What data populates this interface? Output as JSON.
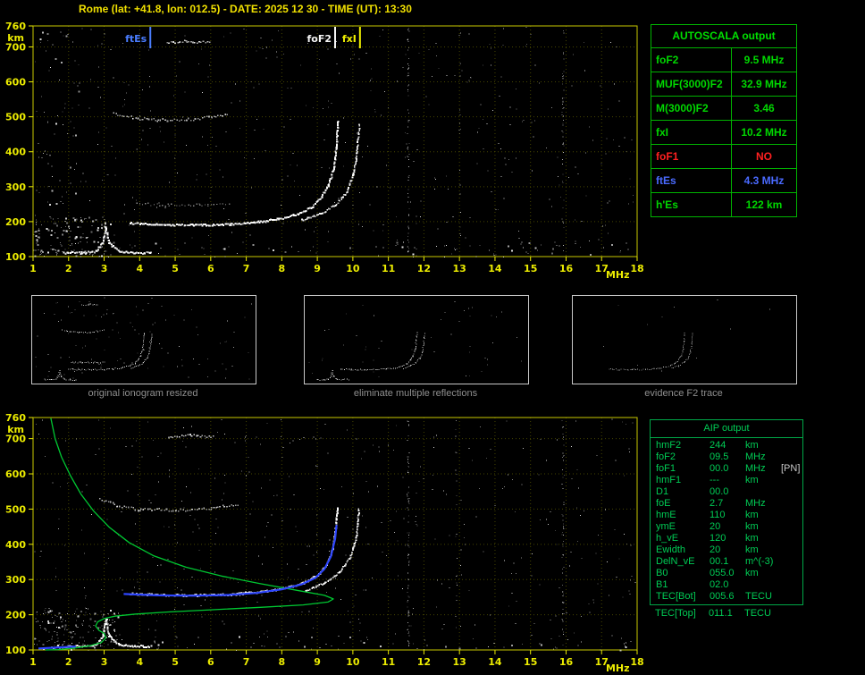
{
  "title": "Rome (lat: +41.8, lon: 012.5) - DATE: 2025 12 30 - TIME (UT): 13:30",
  "colors": {
    "green": "#00d800",
    "red": "#ff2020",
    "blue": "#4a6aff",
    "yellow": "#f0f000",
    "white": "#f5f5f5",
    "axis": "#ecec00"
  },
  "autoscala_table": {
    "header": "AUTOSCALA output",
    "rows": [
      {
        "label": "foF2",
        "value": "9.5 MHz",
        "color": "green"
      },
      {
        "label": "MUF(3000)F2",
        "value": "32.9 MHz",
        "color": "green"
      },
      {
        "label": "M(3000)F2",
        "value": "3.46",
        "color": "green"
      },
      {
        "label": "fxI",
        "value": "10.2 MHz",
        "color": "green"
      },
      {
        "label": "foF1",
        "value": "NO",
        "color": "red"
      },
      {
        "label": "ftEs",
        "value": "4.3 MHz",
        "color": "blue"
      },
      {
        "label": "h'Es",
        "value": "122  km",
        "color": "green"
      }
    ]
  },
  "aip_table": {
    "header": "AIP output",
    "rows": [
      {
        "label": "hmF2",
        "value": "244",
        "unit": "km",
        "extra": ""
      },
      {
        "label": "foF2",
        "value": "09.5",
        "unit": "MHz",
        "extra": ""
      },
      {
        "label": "foF1",
        "value": "00.0",
        "unit": "MHz",
        "extra": "[PN]"
      },
      {
        "label": "hmF1",
        "value": "---",
        "unit": "km",
        "extra": ""
      },
      {
        "label": "D1",
        "value": "00.0",
        "unit": "",
        "extra": ""
      },
      {
        "label": "foE",
        "value": "2.7",
        "unit": "MHz",
        "extra": ""
      },
      {
        "label": "hmE",
        "value": "110",
        "unit": "km",
        "extra": ""
      },
      {
        "label": "ymE",
        "value": "20",
        "unit": "km",
        "extra": ""
      },
      {
        "label": "h_vE",
        "value": "120",
        "unit": "km",
        "extra": ""
      },
      {
        "label": "Ewidth",
        "value": "20",
        "unit": "km",
        "extra": ""
      },
      {
        "label": "DelN_vE",
        "value": "00.1",
        "unit": "m^(-3)",
        "extra": ""
      },
      {
        "label": "B0",
        "value": "055.0",
        "unit": "km",
        "extra": ""
      },
      {
        "label": "B1",
        "value": "02.0",
        "unit": "",
        "extra": ""
      },
      {
        "label": "TEC[Bot]",
        "value": "005.6",
        "unit": "TECU",
        "extra": ""
      }
    ],
    "outside_row": {
      "label": "TEC[Top]",
      "value": "011.1",
      "unit": "TECU",
      "extra": ""
    }
  },
  "thumbnails": [
    {
      "caption": "original ionogram resized",
      "traces": [
        "Es-layer",
        "F-trace-ordinary",
        "F-trace-extraordinary",
        "F-mid-faint",
        "F2-second-order",
        "multiple-700km"
      ],
      "noise": 110,
      "opacity": 0.95,
      "seed": 3
    },
    {
      "caption": "eliminate multiple reflections",
      "traces": [
        "Es-layer",
        "F-trace-ordinary",
        "F-trace-extraordinary"
      ],
      "noise": 45,
      "opacity": 0.95,
      "seed": 4
    },
    {
      "caption": "evidence F2 trace",
      "traces": [
        "F-trace-ordinary",
        "F-trace-extraordinary"
      ],
      "noise": 12,
      "opacity": 0.7,
      "seed": 5
    }
  ],
  "chart_data": [
    {
      "id": "top-ionogram",
      "type": "scatter",
      "title": "autoscaled ionogram",
      "xlabel": "MHz",
      "ylabel": "km",
      "xlim": [
        1,
        18
      ],
      "ylim": [
        100,
        760
      ],
      "xticks": [
        1,
        2,
        3,
        4,
        5,
        6,
        7,
        8,
        9,
        10,
        11,
        12,
        13,
        14,
        15,
        16,
        17,
        18
      ],
      "yticks": [
        100,
        200,
        300,
        400,
        500,
        600,
        700,
        760
      ],
      "markers": [
        {
          "label": "ftEs",
          "x": 4.3,
          "color": "#4a7dff"
        },
        {
          "label": "foF2",
          "x": 9.5,
          "color": "#f5f5f5"
        },
        {
          "label": "fxI",
          "x": 10.2,
          "color": "#f0f000"
        }
      ],
      "traces": [
        {
          "name": "Es-layer",
          "color": "#ffffff",
          "size": 2,
          "step": 1.7,
          "jitter": 1.0,
          "points": [
            [
              1.85,
              112
            ],
            [
              2.35,
              113
            ],
            [
              2.75,
              117
            ],
            [
              2.95,
              142
            ],
            [
              3.03,
              186
            ],
            [
              3.12,
              142
            ],
            [
              3.4,
              117
            ],
            [
              3.85,
              113
            ],
            [
              4.3,
              112
            ]
          ]
        },
        {
          "name": "F-trace-ordinary",
          "color": "#ffffff",
          "size": 2,
          "step": 1.6,
          "jitter": 1.0,
          "points": [
            [
              3.7,
              198
            ],
            [
              4.5,
              193
            ],
            [
              5.5,
              192
            ],
            [
              6.5,
              194
            ],
            [
              7.2,
              199
            ],
            [
              7.9,
              210
            ],
            [
              8.45,
              224
            ],
            [
              8.85,
              245
            ],
            [
              9.1,
              272
            ],
            [
              9.3,
              308
            ],
            [
              9.45,
              358
            ],
            [
              9.52,
              425
            ],
            [
              9.56,
              490
            ]
          ]
        },
        {
          "name": "F-trace-extraordinary",
          "color": "#ffffff",
          "size": 1.8,
          "step": 1.8,
          "jitter": 1.0,
          "points": [
            [
              8.55,
              206
            ],
            [
              9.1,
              224
            ],
            [
              9.5,
              250
            ],
            [
              9.82,
              288
            ],
            [
              10.0,
              338
            ],
            [
              10.1,
              400
            ],
            [
              10.16,
              480
            ]
          ]
        },
        {
          "name": "F-mid-faint",
          "color": "#ffffff",
          "size": 1.4,
          "step": 3.2,
          "jitter": 1.4,
          "op": 0.5,
          "points": [
            [
              3.9,
              253
            ],
            [
              4.8,
              249
            ],
            [
              5.9,
              250
            ],
            [
              6.5,
              254
            ]
          ]
        },
        {
          "name": "F2-second-order",
          "color": "#ffffff",
          "size": 1.6,
          "step": 2.6,
          "jitter": 1.6,
          "op": 0.7,
          "points": [
            [
              3.25,
              512
            ],
            [
              3.8,
              499
            ],
            [
              4.5,
              492
            ],
            [
              5.3,
              493
            ],
            [
              6.0,
              500
            ],
            [
              6.45,
              509
            ]
          ]
        },
        {
          "name": "multiple-700km",
          "color": "#ffffff",
          "size": 1.6,
          "step": 2.4,
          "jitter": 1.2,
          "op": 0.8,
          "points": [
            [
              4.75,
              713
            ],
            [
              5.3,
              718
            ],
            [
              5.95,
              714
            ]
          ]
        }
      ],
      "noise": {
        "seed": 13,
        "count": 380,
        "regions": [
          {
            "x": [
              1,
              3.2
            ],
            "y": [
              100,
              215
            ],
            "count": 140
          },
          {
            "x": [
              1,
              17.8
            ],
            "y": [
              100,
              145
            ],
            "count": 80
          },
          {
            "x": [
              1.05,
              2.3
            ],
            "y": [
              215,
              755
            ],
            "count": 50
          }
        ]
      },
      "streaks": [
        {
          "x": 11.55,
          "count": 70
        },
        {
          "x": 15.9,
          "count": 45
        },
        {
          "x": 13.0,
          "count": 18
        }
      ]
    },
    {
      "id": "bottom-ionogram",
      "type": "scatter",
      "title": "ionogram with restored trace and electron density profile",
      "xlabel": "MHz",
      "ylabel": "km",
      "xlim": [
        1,
        18
      ],
      "ylim": [
        100,
        760
      ],
      "xticks": [
        1,
        2,
        3,
        4,
        5,
        6,
        7,
        8,
        9,
        10,
        11,
        12,
        13,
        14,
        15,
        16,
        17,
        18
      ],
      "yticks": [
        100,
        200,
        300,
        400,
        500,
        600,
        700,
        760
      ],
      "markers": [],
      "traces": [
        {
          "name": "Es-layer",
          "color": "#ffffff",
          "size": 2,
          "step": 1.7,
          "jitter": 1.0,
          "points": [
            [
              1.85,
              112
            ],
            [
              2.35,
              113
            ],
            [
              2.75,
              117
            ],
            [
              2.95,
              142
            ],
            [
              3.03,
              186
            ],
            [
              3.12,
              142
            ],
            [
              3.4,
              117
            ],
            [
              3.85,
              113
            ],
            [
              4.3,
              112
            ]
          ]
        },
        {
          "name": "F-trace-ordinary",
          "color": "#ffffff",
          "size": 2,
          "step": 1.6,
          "jitter": 1.0,
          "points": [
            [
              3.7,
              262
            ],
            [
              4.6,
              258
            ],
            [
              5.6,
              257
            ],
            [
              6.6,
              260
            ],
            [
              7.4,
              267
            ],
            [
              8.1,
              278
            ],
            [
              8.6,
              293
            ],
            [
              9.0,
              315
            ],
            [
              9.25,
              345
            ],
            [
              9.42,
              390
            ],
            [
              9.5,
              450
            ],
            [
              9.54,
              505
            ]
          ]
        },
        {
          "name": "F-trace-extraordinary",
          "color": "#ffffff",
          "size": 1.8,
          "step": 1.8,
          "jitter": 1.0,
          "points": [
            [
              8.65,
              270
            ],
            [
              9.2,
              292
            ],
            [
              9.6,
              322
            ],
            [
              9.9,
              362
            ],
            [
              10.08,
              420
            ],
            [
              10.15,
              500
            ]
          ]
        },
        {
          "name": "F2-second-order",
          "color": "#ffffff",
          "size": 1.6,
          "step": 2.6,
          "jitter": 1.6,
          "op": 0.7,
          "points": [
            [
              2.85,
              532
            ],
            [
              3.35,
              512
            ],
            [
              4.0,
              501
            ],
            [
              5.0,
              498
            ],
            [
              6.0,
              504
            ],
            [
              6.75,
              516
            ]
          ]
        },
        {
          "name": "multiple-700km",
          "color": "#ffffff",
          "size": 1.6,
          "step": 2.4,
          "jitter": 1.2,
          "op": 0.8,
          "points": [
            [
              4.8,
              706
            ],
            [
              5.4,
              711
            ],
            [
              6.05,
              707
            ]
          ]
        }
      ],
      "lines": [
        {
          "name": "electron-density-profile",
          "color": "#00c832",
          "width": 1.3,
          "points": [
            [
              1.5,
              758
            ],
            [
              1.62,
              700
            ],
            [
              1.8,
              648
            ],
            [
              2.05,
              595
            ],
            [
              2.35,
              542
            ],
            [
              2.7,
              495
            ],
            [
              3.15,
              448
            ],
            [
              3.7,
              405
            ],
            [
              4.4,
              367
            ],
            [
              5.3,
              335
            ],
            [
              6.3,
              310
            ],
            [
              7.4,
              288
            ],
            [
              8.5,
              268
            ],
            [
              9.2,
              255
            ],
            [
              9.45,
              245
            ],
            [
              9.3,
              236
            ],
            [
              8.6,
              228
            ],
            [
              7.4,
              221
            ],
            [
              6.0,
              214
            ],
            [
              4.8,
              208
            ],
            [
              3.9,
              202
            ],
            [
              3.3,
              196
            ],
            [
              3.0,
              189
            ],
            [
              2.82,
              180
            ],
            [
              2.76,
              168
            ],
            [
              2.85,
              156
            ],
            [
              3.0,
              147
            ],
            [
              3.05,
              134
            ],
            [
              2.92,
              121
            ],
            [
              2.6,
              112
            ],
            [
              2.15,
              105
            ],
            [
              1.7,
              101
            ],
            [
              1.35,
              100
            ]
          ]
        },
        {
          "name": "restored-trace",
          "color": "#2e46ff",
          "width": 2.2,
          "points": [
            [
              3.55,
              259
            ],
            [
              4.5,
              255
            ],
            [
              5.5,
              254
            ],
            [
              6.5,
              256
            ],
            [
              7.3,
              262
            ],
            [
              8.0,
              272
            ],
            [
              8.55,
              286
            ],
            [
              8.95,
              305
            ],
            [
              9.2,
              330
            ],
            [
              9.38,
              365
            ],
            [
              9.5,
              415
            ],
            [
              9.54,
              455
            ]
          ]
        },
        {
          "name": "restored-es",
          "color": "#2e46ff",
          "width": 2.2,
          "points": [
            [
              1.15,
              104
            ],
            [
              1.7,
              107
            ],
            [
              2.2,
              110
            ]
          ]
        }
      ],
      "noise": {
        "seed": 29,
        "count": 420,
        "regions": [
          {
            "x": [
              1,
              3.4
            ],
            "y": [
              100,
              220
            ],
            "count": 150
          },
          {
            "x": [
              1,
              17.8
            ],
            "y": [
              100,
              140
            ],
            "count": 80
          }
        ]
      },
      "streaks": [
        {
          "x": 11.55,
          "count": 80
        },
        {
          "x": 15.9,
          "count": 55
        },
        {
          "x": 12.9,
          "count": 22
        }
      ]
    }
  ]
}
